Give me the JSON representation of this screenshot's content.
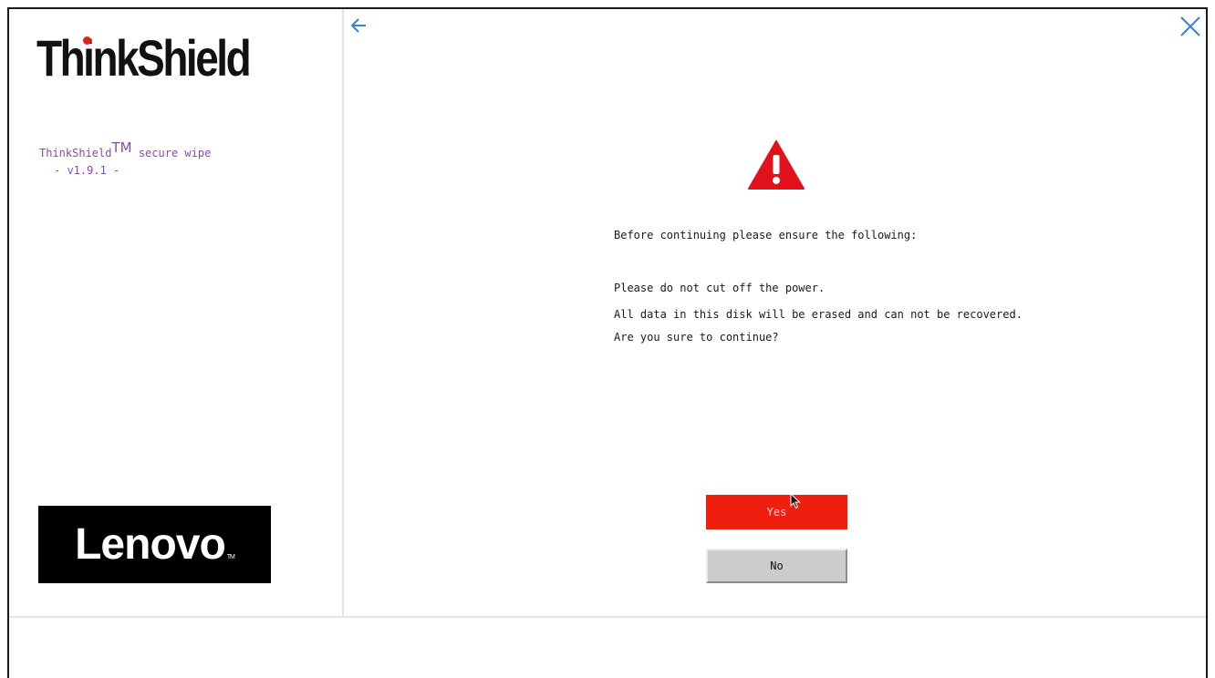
{
  "sidebar": {
    "brand_wordmark": "ThinkShield",
    "app_name": "ThinkShield",
    "app_name_tm": "TM",
    "app_name_suffix": " secure wipe",
    "app_version": "- v1.9.1 -",
    "logo_text": "Lenovo",
    "logo_tm": "TM"
  },
  "toolbar": {
    "back_icon": "arrow-left-icon",
    "close_icon": "close-icon"
  },
  "dialog": {
    "warning_icon": "warning-triangle-icon",
    "heading": "Before continuing please ensure the following:",
    "lines": [
      "Please do not cut off the power.",
      "All data in this disk will be erased and can not be recovered.",
      "Are you sure to continue?"
    ],
    "yes_label": "Yes",
    "no_label": "No"
  },
  "colors": {
    "accent_red": "#f01e0f",
    "icon_blue": "#3b7fd6",
    "brand_purple": "#8a4aa8"
  }
}
